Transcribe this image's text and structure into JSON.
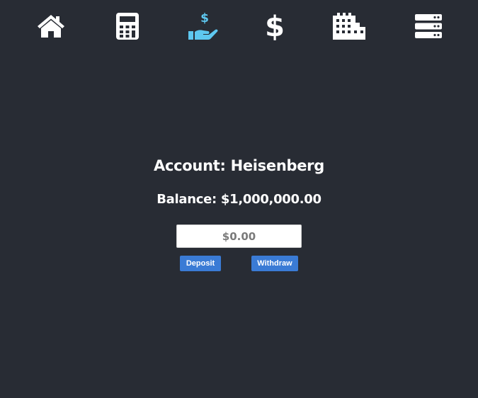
{
  "nav": {
    "items": [
      {
        "icon": "home-icon",
        "active": false
      },
      {
        "icon": "calculator-icon",
        "active": false
      },
      {
        "icon": "hand-holding-dollar-icon",
        "active": true
      },
      {
        "icon": "dollar-icon",
        "active": false
      },
      {
        "icon": "industry-icon",
        "active": false
      },
      {
        "icon": "server-icon",
        "active": false
      }
    ],
    "icon_color": "#ffffff",
    "active_color": "#5ec8f0"
  },
  "account": {
    "title": "Account: Heisenberg",
    "balance": "Balance: $1,000,000.00"
  },
  "amount": {
    "placeholder": "$0.00"
  },
  "actions": {
    "deposit_label": "Deposit",
    "withdraw_label": "Withdraw"
  },
  "colors": {
    "background": "#282c34",
    "button": "#3a7bd5"
  }
}
